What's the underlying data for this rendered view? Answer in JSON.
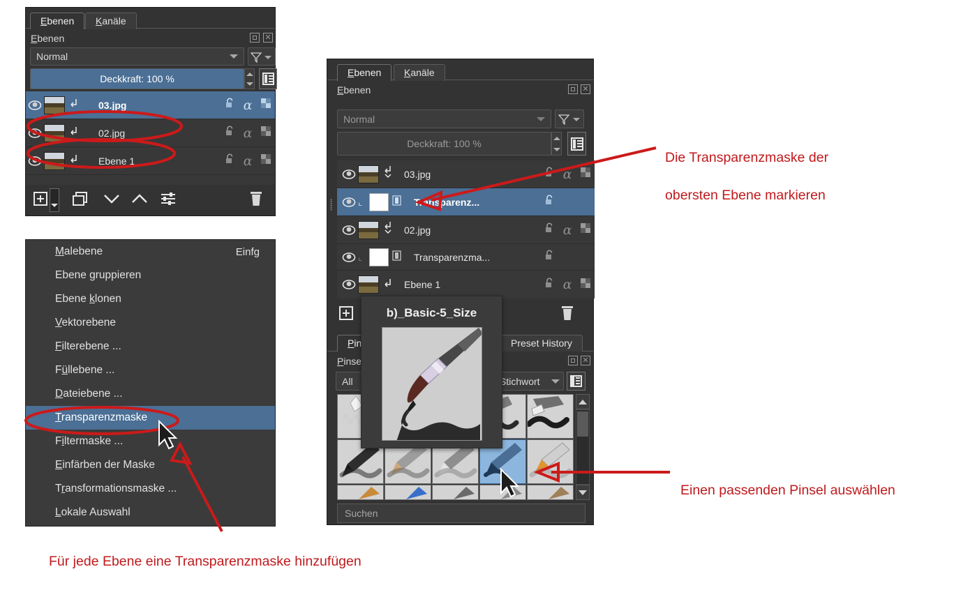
{
  "colors": {
    "panel_bg": "#333333",
    "list_bg": "#383838",
    "selection_blue": "#4b6f95",
    "annotation_red": "#c0191c",
    "text": "#e0e0e0"
  },
  "left_panel": {
    "tabs": [
      {
        "label": "Ebenen",
        "accesskey": "E",
        "active": true
      },
      {
        "label": "Kanäle",
        "accesskey": "K",
        "active": false
      }
    ],
    "section_label": "Ebenen",
    "header_icons": [
      "float-docker-icon",
      "close-docker-icon"
    ],
    "blend_mode": "Normal",
    "filter_icon": "funnel-icon",
    "opacity_label": "Deckkraft:  100 %",
    "properties_icon": "layer-properties-icon",
    "layers": [
      {
        "name": "03.jpg",
        "selected": true,
        "visible": true,
        "thumb": "image-thumbnail",
        "has_inherit_alpha": true
      },
      {
        "name": "02.jpg",
        "selected": false,
        "visible": true,
        "thumb": "image-thumbnail",
        "has_inherit_alpha": true
      },
      {
        "name": "Ebene 1",
        "selected": false,
        "visible": true,
        "thumb": "image-thumbnail",
        "has_inherit_alpha": true
      }
    ],
    "toolbar_icons": [
      "add-layer-icon",
      "add-layer-dropdown-icon",
      "duplicate-layer-icon",
      "move-layer-down-icon",
      "move-layer-up-icon",
      "layer-properties-slider-icon",
      "delete-layer-icon"
    ]
  },
  "context_menu": {
    "items": [
      {
        "label": "Malebene",
        "accesskey": "M",
        "shortcut": "Einfg",
        "selected": false
      },
      {
        "label": "Ebene gruppieren",
        "accesskey": "g",
        "shortcut": "",
        "selected": false
      },
      {
        "label": "Ebene klonen",
        "accesskey": "k",
        "shortcut": "",
        "selected": false
      },
      {
        "label": "Vektorebene",
        "accesskey": "V",
        "shortcut": "",
        "selected": false
      },
      {
        "label": "Filterebene ...",
        "accesskey": "F",
        "shortcut": "",
        "selected": false
      },
      {
        "label": "Füllebene ...",
        "accesskey": "ü",
        "shortcut": "",
        "selected": false
      },
      {
        "label": "Dateiebene ...",
        "accesskey": "D",
        "shortcut": "",
        "selected": false
      },
      {
        "label": "Transparenzmaske",
        "accesskey": "T",
        "shortcut": "",
        "selected": true
      },
      {
        "label": "Filtermaske ...",
        "accesskey": "i",
        "shortcut": "",
        "selected": false
      },
      {
        "label": "Einfärben der Maske",
        "accesskey": "E",
        "shortcut": "",
        "selected": false
      },
      {
        "label": "Transformationsmaske ...",
        "accesskey": "r",
        "shortcut": "",
        "selected": false
      },
      {
        "label": "Lokale Auswahl",
        "accesskey": "L",
        "shortcut": "",
        "selected": false
      }
    ]
  },
  "right_panel": {
    "tabs": [
      {
        "label": "Ebenen",
        "accesskey": "E",
        "active": true
      },
      {
        "label": "Kanäle",
        "accesskey": "K",
        "active": false
      }
    ],
    "section_label": "Ebenen",
    "blend_mode": "Normal",
    "opacity_label": "Deckkraft:  100 %",
    "layers": [
      {
        "name": "03.jpg",
        "type": "layer",
        "selected": false,
        "visible": true
      },
      {
        "name": "Transparenz...",
        "type": "mask",
        "selected": true,
        "visible": true
      },
      {
        "name": "02.jpg",
        "type": "layer",
        "selected": false,
        "visible": true
      },
      {
        "name": "Transparenzma...",
        "type": "mask",
        "selected": false,
        "visible": true
      },
      {
        "name": "Ebene 1",
        "type": "layer",
        "selected": false,
        "visible": true
      }
    ],
    "toolbar_icons": [
      "add-layer-icon",
      "delete-layer-icon"
    ]
  },
  "brush_docker": {
    "tabs": [
      {
        "label": "Pin",
        "truncated": true,
        "active": true
      },
      {
        "label": "Preset History",
        "truncated": false,
        "active": false
      }
    ],
    "section_label": "Pinse",
    "filter_value": "All",
    "tag_label": "Stichwort",
    "list_icon": "list-view-icon",
    "search_placeholder": "Suchen",
    "scroll_up_icon": "scroll-up-arrow",
    "scroll_down_icon": "scroll-down-arrow",
    "presets_row2": [
      {
        "name": "brush-preset-1",
        "selected": false
      },
      {
        "name": "brush-preset-2",
        "selected": false
      },
      {
        "name": "brush-preset-3",
        "selected": false
      },
      {
        "name": "brush-preset-4-selected",
        "selected": true
      },
      {
        "name": "brush-preset-5",
        "selected": false
      }
    ]
  },
  "tooltip": {
    "title": "b)_Basic-5_Size",
    "preview": "brush-stroke-preview"
  },
  "annotations": [
    {
      "id": "anno-top",
      "text": "Die Transparenzmaske der\noberstenEbene markieren"
    },
    {
      "id": "anno-brush",
      "text": "Einen passenden Pinsel auswählen"
    },
    {
      "id": "anno-bottom",
      "text": "Für jede Ebene eine Transparenzmaske hinzufügen"
    }
  ],
  "annotation_texts": {
    "top": "Die Transparenzmaske der\noberstenEbene markieren",
    "top_line1": "Die Transparenzmaske der",
    "top_line2": "obersten Ebene markieren",
    "brush": "Einen passenden Pinsel auswählen",
    "bottom": "Für jede Ebene eine Transparenzmaske hinzufügen"
  }
}
